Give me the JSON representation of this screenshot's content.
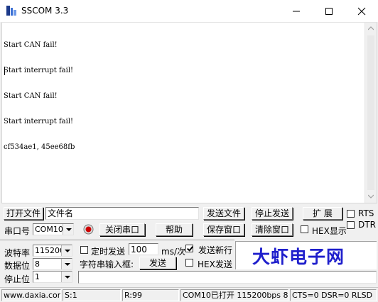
{
  "window": {
    "title": "SSCOM 3.3"
  },
  "terminal": {
    "lines": [
      "Start CAN fail!",
      "Start interrupt fail!",
      "Start CAN fail!",
      "Start interrupt fail!",
      "cf534ae1, 45ee68fb"
    ]
  },
  "row1": {
    "open_file_label": "打开文件",
    "filename_value": "文件名",
    "send_file_label": "发送文件",
    "stop_send_label": "停止发送",
    "expand_label": "扩 展",
    "rts_label": "RTS"
  },
  "row2": {
    "port_label": "串口号",
    "port_value": "COM10",
    "close_port_label": "关闭串口",
    "help_label": "帮助",
    "save_window_label": "保存窗口",
    "clear_window_label": "清除窗口",
    "hex_display_label": "HEX显示",
    "dtr_label": "DTR"
  },
  "settings": {
    "baud_label": "波特率",
    "baud_value": "115200",
    "databits_label": "数据位",
    "databits_value": "8",
    "stopbits_label": "停止位",
    "stopbits_value": "1",
    "timed_send_label": "定时发送",
    "interval_value": "100",
    "interval_unit": "ms/次",
    "send_newline_label": "发送新行",
    "string_input_label": "字符串输入框:",
    "send_label": "发送",
    "hex_send_label": "HEX发送"
  },
  "logo": {
    "text": "大虾电子网"
  },
  "statusbar": {
    "website": "www.daxia.com",
    "sent": "S:1",
    "received": "R:99",
    "port_status": "COM10已打开  115200bps  8",
    "lines_status": "CTS=0 DSR=0 RLSD"
  },
  "colors": {
    "logo_blue": "#1f1fcc",
    "record_red": "#cc0000"
  }
}
